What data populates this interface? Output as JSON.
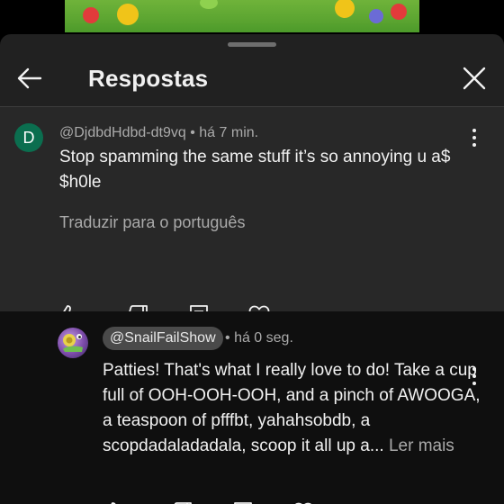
{
  "header": {
    "title": "Respostas"
  },
  "parent_comment": {
    "avatar_letter": "D",
    "author": "@DjdbdHdbd-dt9vq",
    "separator": "•",
    "time": "há 7 min.",
    "text": "Stop spamming the same stuff it’s so annoying u a$ $h0le",
    "translate_label": "Traduzir para o português"
  },
  "reply": {
    "author": "@SnailFailShow",
    "separator": "•",
    "time": "há 0 seg.",
    "text": "Patties! That's what I really love to do! Take a cup full of OOH-OOH-OOH, and a pinch of AWOOGA, a teaspoon of pfffbt, yahahsobdb, a scopdadaladadala, scoop it all up a...",
    "more_label": "Ler mais"
  },
  "icons": {
    "back": "arrow-left-icon",
    "close": "close-icon",
    "menu": "more-vertical-icon",
    "like": "thumb-up-icon",
    "dislike": "thumb-down-icon",
    "reply": "comment-icon",
    "heart": "heart-icon"
  },
  "colors": {
    "sheet_bg": "#212121",
    "parent_bg": "#282828",
    "reply_bg": "#0f0f0f",
    "avatar_d": "#0b6e4f",
    "secondary_text": "#aaaaaa"
  }
}
